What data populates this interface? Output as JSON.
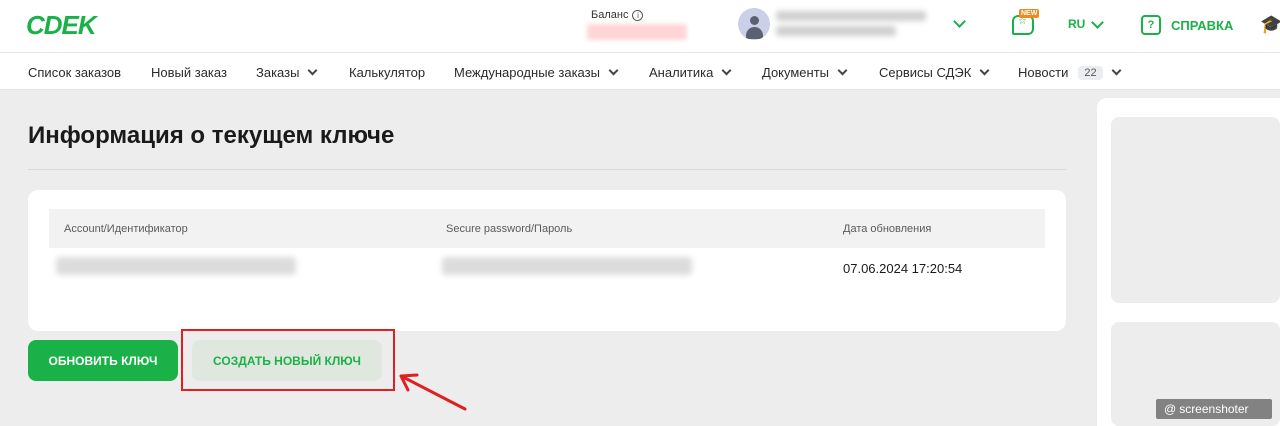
{
  "header": {
    "logo_text": "CDEK",
    "balance_label": "Баланс",
    "balance_value": "",
    "user_name": "",
    "new_badge": "NEW",
    "language": "RU",
    "help_label": "СПРАВКА"
  },
  "nav": {
    "items": [
      {
        "label": "Список заказов"
      },
      {
        "label": "Новый заказ"
      },
      {
        "label": "Заказы"
      },
      {
        "label": "Калькулятор"
      },
      {
        "label": "Международные заказы"
      },
      {
        "label": "Аналитика"
      },
      {
        "label": "Документы"
      },
      {
        "label": "Сервисы СДЭК"
      },
      {
        "label": "Новости",
        "badge": "22"
      }
    ]
  },
  "page": {
    "title": "Информация о текущем ключе"
  },
  "table": {
    "columns": [
      "Account/Идентификатор",
      "Secure password/Пароль",
      "Дата обновления"
    ],
    "rows": [
      {
        "account": "",
        "password": "",
        "updated": "07.06.2024 17:20:54"
      }
    ]
  },
  "actions": {
    "update_label": "ОБНОВИТЬ КЛЮЧ",
    "create_label": "СОЗДАТЬ НОВЫЙ КЛЮЧ"
  },
  "watermark": "screenshoter",
  "colors": {
    "brand_green": "#1ab248",
    "highlight_red": "#e02020",
    "badge_orange": "#f08a1c"
  }
}
